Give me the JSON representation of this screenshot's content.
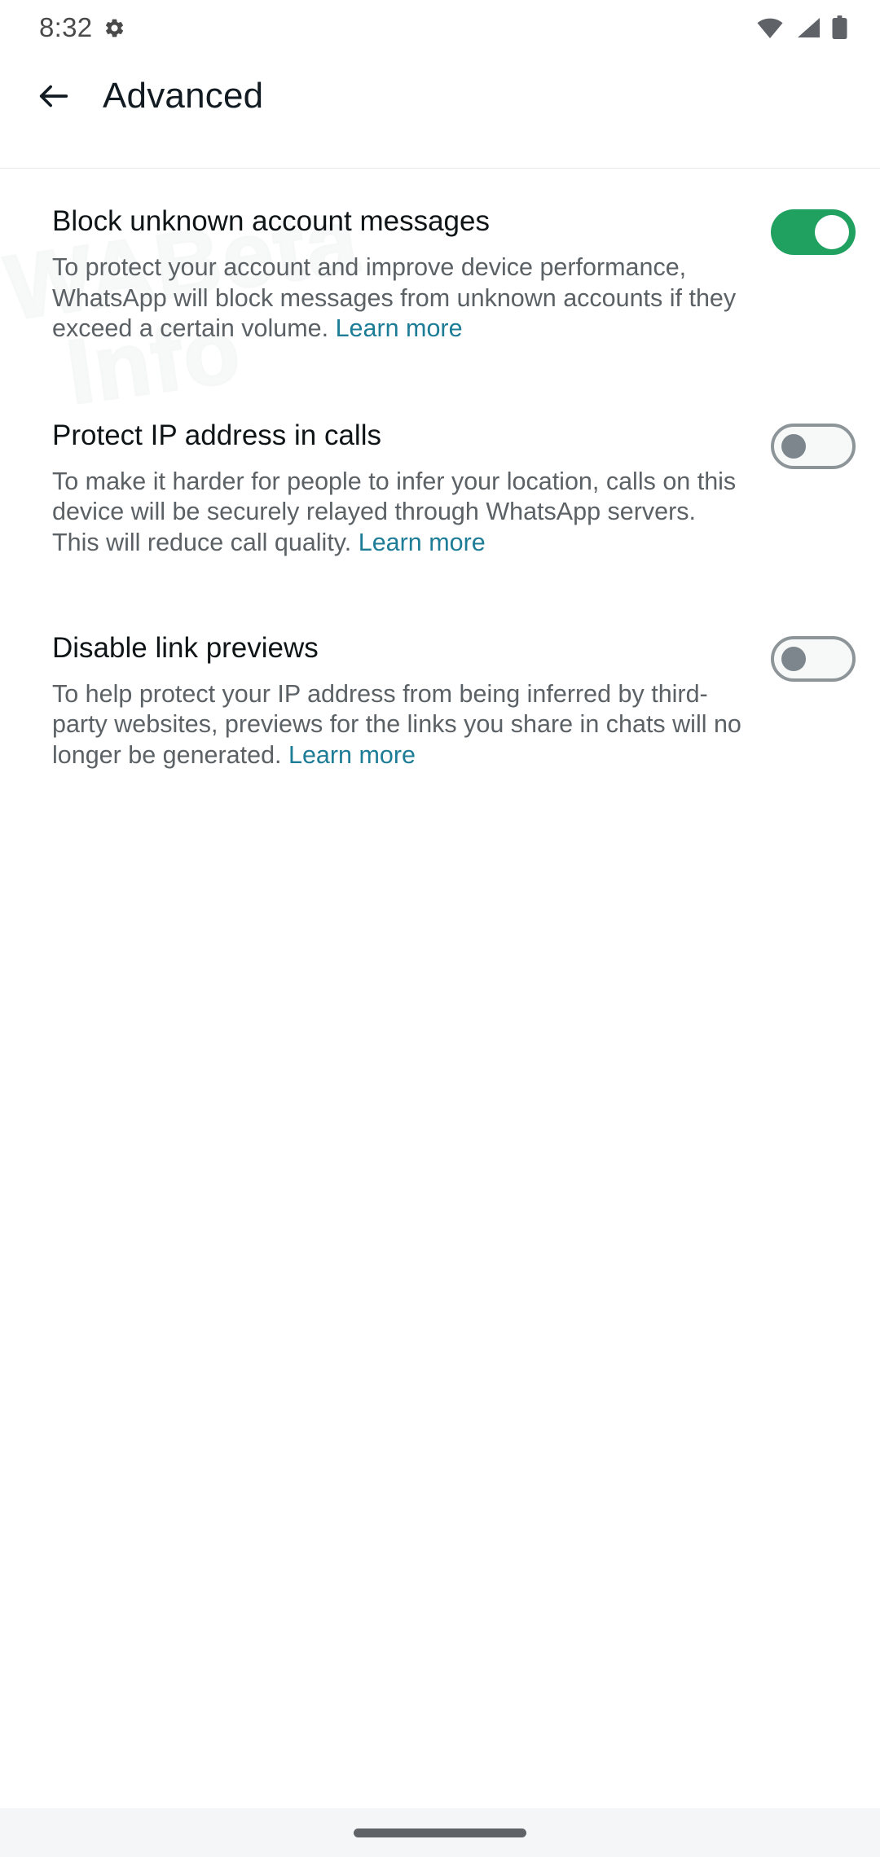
{
  "status_bar": {
    "time": "8:32",
    "icons": [
      "gear-icon",
      "wifi-icon",
      "cellular-signal-icon",
      "battery-icon"
    ]
  },
  "app_bar": {
    "back_label": "back-arrow",
    "title": "Advanced"
  },
  "watermark": {
    "line1": "WABeta",
    "line2": "Info"
  },
  "colors": {
    "toggle_on": "#21a160",
    "toggle_off_track": "#f7f8f8",
    "toggle_off_border": "#8d9599",
    "toggle_off_knob": "#7c868c",
    "link": "#1d7c96",
    "title_text": "#0f1417",
    "desc_text": "#5b6165",
    "nav_bar_bg": "#f5f6f7"
  },
  "settings": [
    {
      "id": "block-unknown-account-messages",
      "title": "Block unknown account messages",
      "description": "To protect your account and improve device performance, WhatsApp will block messages from unknown accounts if they exceed a certain volume. ",
      "link_label": "Learn more",
      "link_inline": true,
      "toggle_state": "on"
    },
    {
      "id": "protect-ip-address-in-calls",
      "title": "Protect IP address in calls",
      "description": "To make it harder for people to infer your location, calls on this device will be securely relayed through WhatsApp servers. This will reduce call quality. ",
      "link_label": "Learn more",
      "link_inline": false,
      "toggle_state": "off"
    },
    {
      "id": "disable-link-previews",
      "title": "Disable link previews",
      "description": "To help protect your IP address from being inferred by third-party websites, previews for the links you share in chats will no longer be generated. ",
      "link_label": "Learn more",
      "link_inline": true,
      "toggle_state": "off"
    }
  ]
}
